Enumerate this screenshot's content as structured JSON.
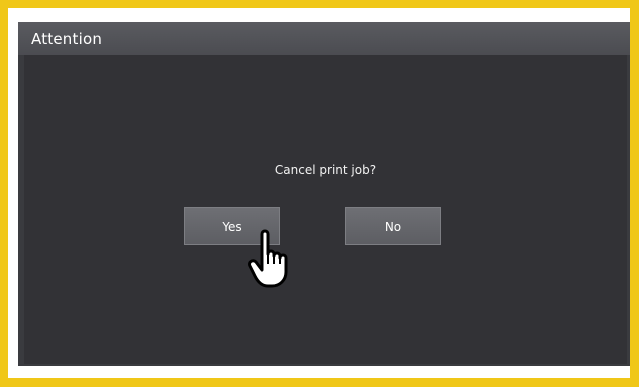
{
  "dialog": {
    "title": "Attention",
    "message": "Cancel print job?",
    "yes_label": "Yes",
    "no_label": "No"
  },
  "pointer": {
    "icon": "hand-pointer-icon"
  },
  "colors": {
    "frame": "#f0c718",
    "titlebar": "#4b4c51",
    "content_bg": "#323236",
    "button_bg": "#6e6f74",
    "text": "#ffffff"
  }
}
